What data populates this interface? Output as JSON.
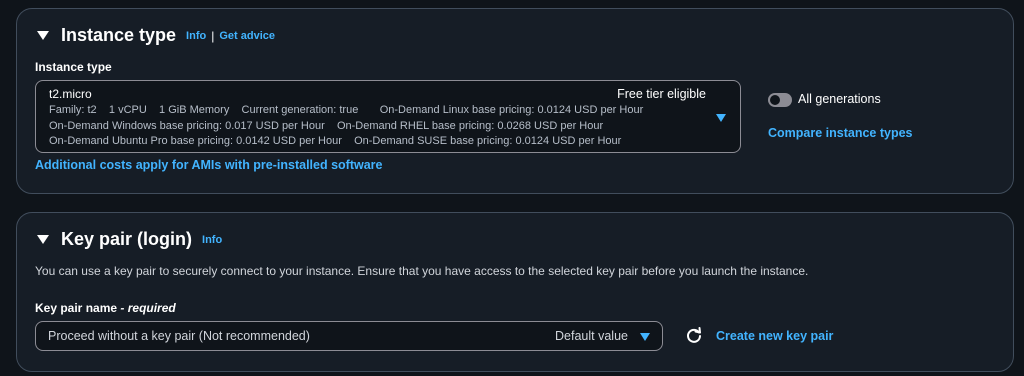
{
  "instance_panel": {
    "title": "Instance type",
    "info": "Info",
    "separator": "|",
    "advice": "Get advice",
    "field_label": "Instance type",
    "selected": {
      "name": "t2.micro",
      "badge": "Free tier eligible",
      "line1": "Family: t2    1 vCPU    1 GiB Memory    Current generation: true       On-Demand Linux base pricing: 0.0124 USD per Hour",
      "line2": "On-Demand Windows base pricing: 0.017 USD per Hour    On-Demand RHEL base pricing: 0.0268 USD per Hour",
      "line3": "On-Demand Ubuntu Pro base pricing: 0.0142 USD per Hour    On-Demand SUSE base pricing: 0.0124 USD per Hour"
    },
    "toggle_label": "All generations",
    "toggle_on": false,
    "compare_link": "Compare instance types",
    "costs_link": "Additional costs apply for AMIs with pre-installed software"
  },
  "keypair_panel": {
    "title": "Key pair (login)",
    "info": "Info",
    "description": "You can use a key pair to securely connect to your instance. Ensure that you have access to the selected key pair before you launch the instance.",
    "field_label": "Key pair name",
    "required": "- required",
    "selected_value": "Proceed without a key pair (Not recommended)",
    "default_tag": "Default value",
    "create_link": "Create new key pair"
  },
  "colors": {
    "background": "#0f141a",
    "panel": "#161d26",
    "border": "#414d5c",
    "link": "#42b4ff"
  }
}
